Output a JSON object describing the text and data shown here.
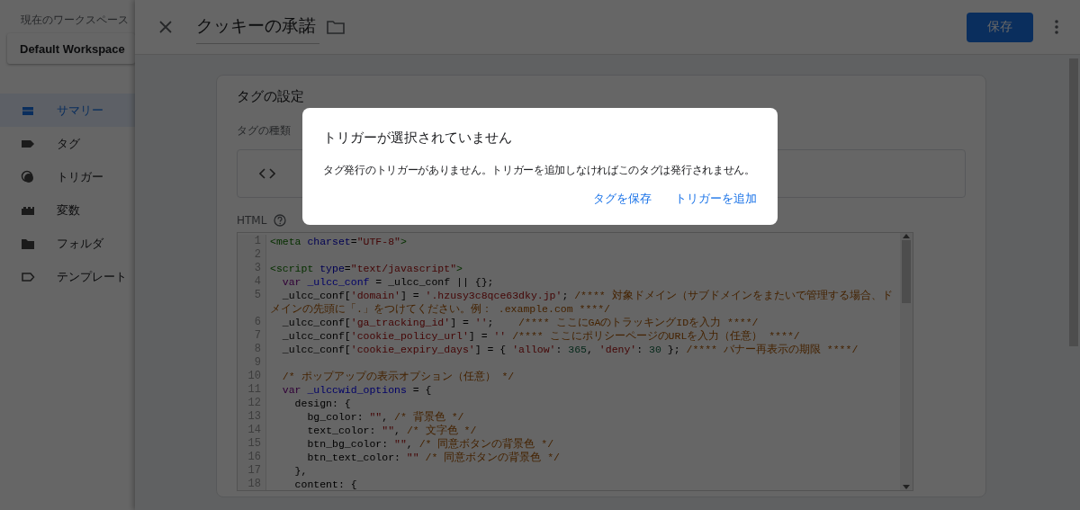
{
  "sidebar": {
    "workspace_label": "現在のワークスペース",
    "workspace": "Default Workspace",
    "items": [
      {
        "label": "サマリー",
        "kind": "summary",
        "selected": true
      },
      {
        "label": "タグ",
        "kind": "tag",
        "selected": false
      },
      {
        "label": "トリガー",
        "kind": "trigger",
        "selected": false
      },
      {
        "label": "変数",
        "kind": "variable",
        "selected": false
      },
      {
        "label": "フォルダ",
        "kind": "folder",
        "selected": false
      },
      {
        "label": "テンプレート",
        "kind": "template",
        "selected": false
      }
    ]
  },
  "editor": {
    "title": "クッキーの承諾",
    "save_button": "保存",
    "card": {
      "heading": "タグの設定",
      "type_label": "タグの種類",
      "html_label": "HTML",
      "code_lines": [
        {
          "number": "1",
          "segments": [
            {
              "kind": "tag",
              "text": "<meta"
            },
            {
              "kind": "attr",
              "text": " charset"
            },
            {
              "kind": "plain",
              "text": "="
            },
            {
              "kind": "string",
              "text": "\"UTF-8\""
            },
            {
              "kind": "tag",
              "text": ">"
            }
          ]
        },
        {
          "number": "2"
        },
        {
          "number": "3",
          "segments": [
            {
              "kind": "tag",
              "text": "<script"
            },
            {
              "kind": "attr",
              "text": " type"
            },
            {
              "kind": "plain",
              "text": "="
            },
            {
              "kind": "string",
              "text": "\"text/javascript\""
            },
            {
              "kind": "tag",
              "text": ">"
            }
          ]
        },
        {
          "number": "4",
          "segments": [
            {
              "kind": "keyword",
              "text": "  var"
            },
            {
              "kind": "def",
              "text": " _ulcc_conf"
            },
            {
              "kind": "plain",
              "text": " = _ulcc_conf || {};"
            }
          ]
        },
        {
          "number": "5",
          "segments": [
            {
              "kind": "plain",
              "text": "  _ulcc_conf["
            },
            {
              "kind": "string",
              "text": "'domain'"
            },
            {
              "kind": "plain",
              "text": "] = "
            },
            {
              "kind": "string",
              "text": "'.hzusy3c8qce63dky.jp'"
            },
            {
              "kind": "plain",
              "text": "; "
            },
            {
              "kind": "comment",
              "text": "/**** 対象ドメイン（サブドメインをまたいで管理する場合、ドメインの先頭に「.」をつけてください。例： .example.com ****/"
            }
          ]
        },
        {
          "number": "6",
          "segments": [
            {
              "kind": "plain",
              "text": "  _ulcc_conf["
            },
            {
              "kind": "string",
              "text": "'ga_tracking_id'"
            },
            {
              "kind": "plain",
              "text": "] = "
            },
            {
              "kind": "string",
              "text": "''"
            },
            {
              "kind": "plain",
              "text": ";    "
            },
            {
              "kind": "comment",
              "text": "/**** ここにGAのトラッキングIDを入力 ****/"
            }
          ]
        },
        {
          "number": "7",
          "segments": [
            {
              "kind": "plain",
              "text": "  _ulcc_conf["
            },
            {
              "kind": "string",
              "text": "'cookie_policy_url'"
            },
            {
              "kind": "plain",
              "text": "] = "
            },
            {
              "kind": "string",
              "text": "''"
            },
            {
              "kind": "comment",
              "text": " /**** ここにポリシーページのURLを入力（任意） ****/"
            }
          ]
        },
        {
          "number": "8",
          "segments": [
            {
              "kind": "plain",
              "text": "  _ulcc_conf["
            },
            {
              "kind": "string",
              "text": "'cookie_expiry_days'"
            },
            {
              "kind": "plain",
              "text": "] = { "
            },
            {
              "kind": "string",
              "text": "'allow'"
            },
            {
              "kind": "plain",
              "text": ": "
            },
            {
              "kind": "number",
              "text": "365"
            },
            {
              "kind": "plain",
              "text": ", "
            },
            {
              "kind": "string",
              "text": "'deny'"
            },
            {
              "kind": "plain",
              "text": ": "
            },
            {
              "kind": "number",
              "text": "30"
            },
            {
              "kind": "plain",
              "text": " }; "
            },
            {
              "kind": "comment",
              "text": "/**** バナー再表示の期限 ****/"
            }
          ]
        },
        {
          "number": "9"
        },
        {
          "number": "10",
          "segments": [
            {
              "kind": "comment",
              "text": "  /* ポップアップの表示オプション（任意） */"
            }
          ]
        },
        {
          "number": "11",
          "segments": [
            {
              "kind": "keyword",
              "text": "  var"
            },
            {
              "kind": "def",
              "text": " _ulccwid_options"
            },
            {
              "kind": "plain",
              "text": " = {"
            }
          ]
        },
        {
          "number": "12",
          "segments": [
            {
              "kind": "plain",
              "text": "    design: {"
            }
          ]
        },
        {
          "number": "13",
          "segments": [
            {
              "kind": "plain",
              "text": "      bg_color: "
            },
            {
              "kind": "string",
              "text": "\"\""
            },
            {
              "kind": "plain",
              "text": ", "
            },
            {
              "kind": "comment",
              "text": "/* 背景色 */"
            }
          ]
        },
        {
          "number": "14",
          "segments": [
            {
              "kind": "plain",
              "text": "      text_color: "
            },
            {
              "kind": "string",
              "text": "\"\""
            },
            {
              "kind": "plain",
              "text": ", "
            },
            {
              "kind": "comment",
              "text": "/* 文字色 */"
            }
          ]
        },
        {
          "number": "15",
          "segments": [
            {
              "kind": "plain",
              "text": "      btn_bg_color: "
            },
            {
              "kind": "string",
              "text": "\"\""
            },
            {
              "kind": "plain",
              "text": ", "
            },
            {
              "kind": "comment",
              "text": "/* 同意ボタンの背景色 */"
            }
          ]
        },
        {
          "number": "16",
          "segments": [
            {
              "kind": "plain",
              "text": "      btn_text_color: "
            },
            {
              "kind": "string",
              "text": "\"\""
            },
            {
              "kind": "comment",
              "text": " /* 同意ボタンの背景色 */"
            }
          ]
        },
        {
          "number": "17",
          "segments": [
            {
              "kind": "plain",
              "text": "    },"
            }
          ]
        },
        {
          "number": "18",
          "segments": [
            {
              "kind": "plain",
              "text": "    content: {"
            }
          ]
        }
      ]
    }
  },
  "dialog": {
    "title": "トリガーが選択されていません",
    "message": "タグ発行のトリガーがありません。トリガーを追加しなければこのタグは発行されません。",
    "actions": [
      "タグを保存",
      "トリガーを追加"
    ]
  }
}
